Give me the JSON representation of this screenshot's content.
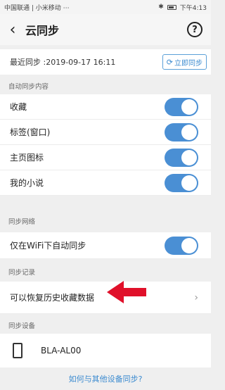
{
  "status_bar": {
    "carrier": "中国联通 | 小米移动 ⋯",
    "time": "下午4:13"
  },
  "header": {
    "back_icon": "back-icon",
    "title": "云同步",
    "help_icon": "help-icon"
  },
  "last_sync": {
    "text": "最近同步 :2019-09-17 16:11",
    "sync_now_label": "立即同步"
  },
  "auto_sync": {
    "section_title": "自动同步内容",
    "items": [
      {
        "label": "收藏",
        "enabled": true
      },
      {
        "label": "标签(窗口)",
        "enabled": true
      },
      {
        "label": "主页图标",
        "enabled": true
      },
      {
        "label": "我的小说",
        "enabled": true
      }
    ]
  },
  "network": {
    "section_title": "同步网络",
    "wifi_only_label": "仅在WiFi下自动同步",
    "wifi_only_enabled": true
  },
  "records": {
    "section_title": "同步记录",
    "restore_label": "可以恢复历史收藏数据"
  },
  "devices": {
    "section_title": "同步设备",
    "device_name": "BLA-AL00"
  },
  "footer": {
    "help_link": "如何与其他设备同步?"
  },
  "colors": {
    "accent": "#4a8fd4",
    "annotation_arrow": "#e0102a"
  }
}
